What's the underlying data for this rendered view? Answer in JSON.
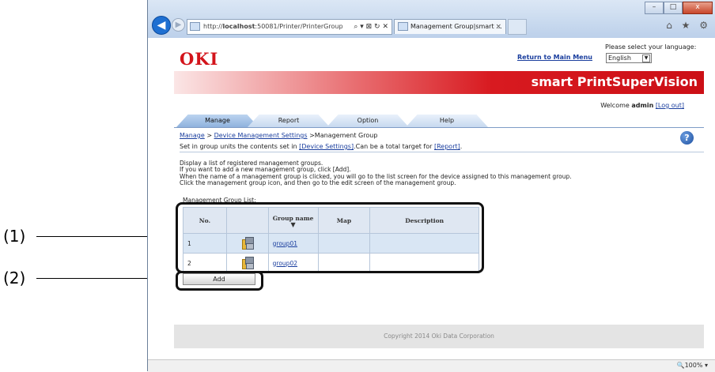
{
  "callouts": [
    "(1)",
    "(2)"
  ],
  "browser": {
    "url_prefix": "http://",
    "url_host": "localhost",
    "url_rest": ":50081/Printer/PrinterGroup",
    "url_controls": "⌕ ▾ ⊠ ↻ ✕",
    "tab_title": "Management Group|smart ...",
    "tab_close": "×",
    "window_controls": {
      "minimize": "–",
      "maximize": "□",
      "close": "x"
    },
    "toolbar_icons": "⌂ ★ ⚙",
    "zoom": "🔍100%  ▾"
  },
  "header": {
    "logo": "OKI",
    "return_link": "Return to Main Menu",
    "language_label": "Please select your language:",
    "language_value": "English",
    "brand": "smart PrintSuperVision",
    "welcome_prefix": "Welcome ",
    "user": "admin",
    "logout": "[Log out]"
  },
  "tabs": [
    "Manage",
    "Report",
    "Option",
    "Help"
  ],
  "breadcrumb": {
    "items": [
      "Manage",
      "Device Management Settings"
    ],
    "sep": " > ",
    "current": "Management Group"
  },
  "description": {
    "pre": "Set in group units the contents set in ",
    "link1": "[Device Settings]",
    "mid": ".Can be a total target for ",
    "link2": "[Report]",
    "post": "."
  },
  "help_icon": "?",
  "info_lines": [
    "Display a list of registered management groups.",
    "If you want to add a new management group, click [Add].",
    "When the name of a management group is clicked, you will go to the list screen for the device assigned to this management group.",
    "Click the management group icon, and then go to the edit screen of the management group."
  ],
  "list_title": "Management Group List:",
  "table": {
    "headers": {
      "no": "No.",
      "name": "Group name",
      "map": "Map",
      "desc": "Description"
    },
    "rows": [
      {
        "no": "1",
        "name": "group01",
        "map": "",
        "desc": ""
      },
      {
        "no": "2",
        "name": "group02",
        "map": "",
        "desc": ""
      }
    ]
  },
  "add_button": "Add",
  "footer": "Copyright 2014 Oki Data Corporation"
}
